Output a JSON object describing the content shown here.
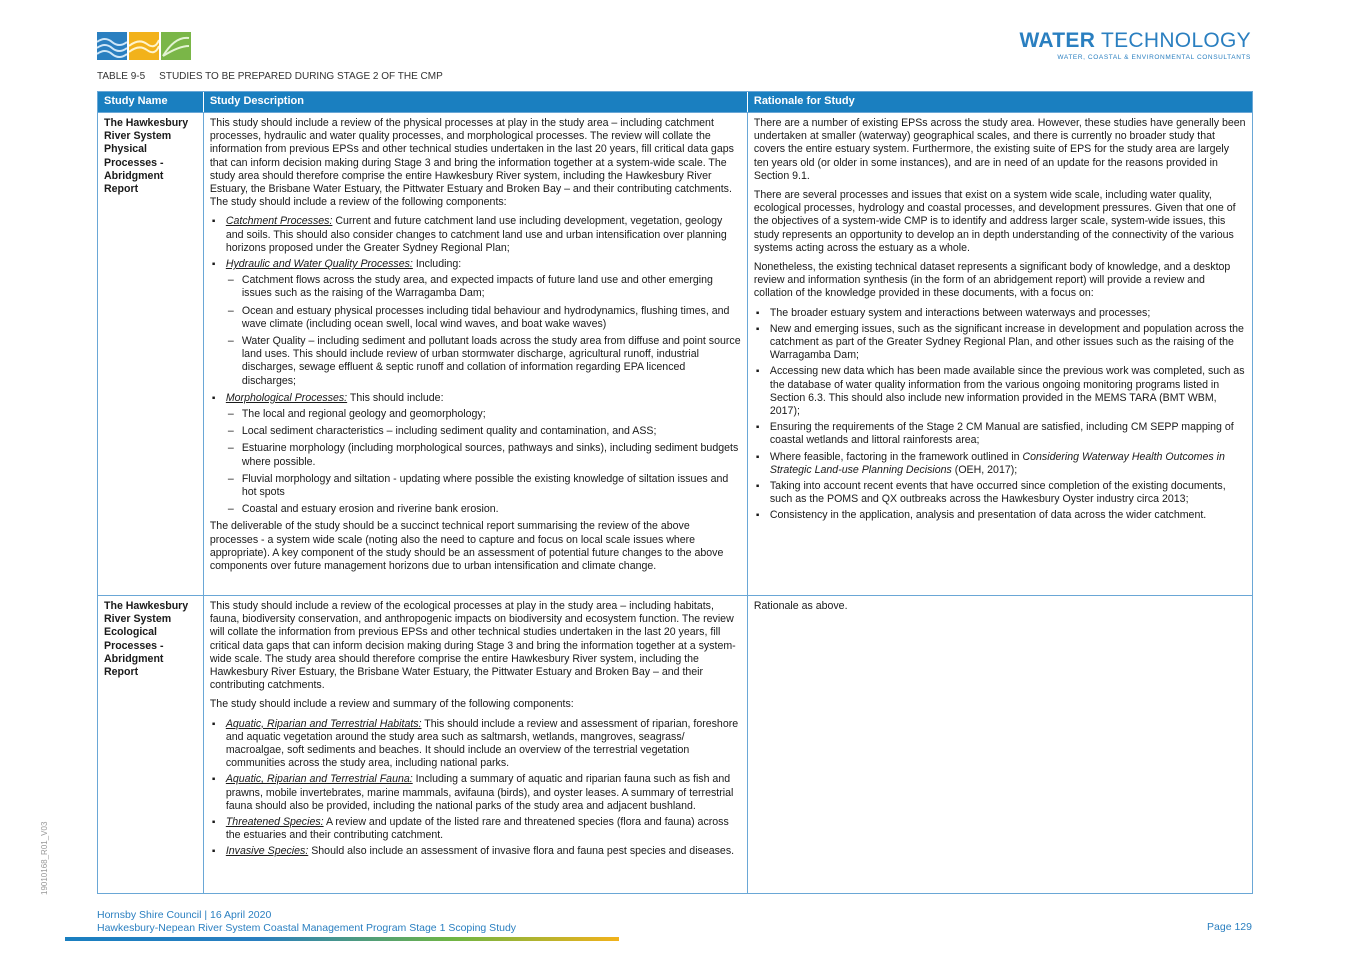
{
  "brand": {
    "name_bold": "WATER",
    "name_light": " TECHNOLOGY",
    "tagline": "WATER, COASTAL & ENVIRONMENTAL CONSULTANTS",
    "color": "#2a7fc0"
  },
  "table_title": {
    "number": "TABLE 9-5",
    "text": "STUDIES TO BE PREPARED DURING STAGE 2 OF THE CMP"
  },
  "headers": [
    "Study Name",
    "Study Description",
    "Rationale for Study"
  ],
  "row1": {
    "name": "The Hawkesbury River System Physical Processes - Abridgment Report",
    "desc_intro": "This study should include a review of the physical processes at play in the study area – including catchment processes, hydraulic and water quality processes, and morphological processes. The review will collate the information from previous EPSs and other technical studies undertaken in the last 20 years, fill critical data gaps that can inform decision making during Stage 3 and bring the information together at a system-wide scale. The study area should therefore comprise the entire Hawkesbury River system, including the Hawkesbury River Estuary, the Brisbane Water Estuary, the Pittwater Estuary and Broken Bay – and their contributing catchments. The study should include a review of the following components:",
    "catchment_title": "Catchment Processes:",
    "catchment_text": " Current and future catchment land use including development, vegetation, geology and soils. This should also consider changes to catchment land use and urban intensification over planning horizons proposed under the Greater Sydney Regional Plan;",
    "hydraulic_title": "Hydraulic and Water Quality Processes:",
    "hydraulic_text": " Including:",
    "hydraulic_items": [
      "Catchment flows across the study area, and expected impacts of future land use and other emerging issues such as the raising of the Warragamba Dam;",
      "Ocean and estuary physical processes including tidal behaviour and hydrodynamics, flushing times, and wave climate (including ocean swell, local wind waves, and boat wake waves)",
      "Water Quality – including sediment and pollutant loads across the study area from diffuse and point source land uses. This should include review of urban stormwater discharge, agricultural runoff, industrial discharges, sewage effluent & septic runoff and collation of information regarding EPA licenced discharges;"
    ],
    "morph_title": "Morphological Processes:",
    "morph_text": " This should include:",
    "morph_items": [
      "The local and regional geology and geomorphology;",
      "Local sediment characteristics – including sediment quality and contamination, and ASS;",
      "Estuarine morphology (including morphological sources, pathways and sinks), including sediment budgets where possible.",
      "Fluvial morphology and siltation - updating where possible the existing knowledge of siltation issues and hot spots",
      "Coastal and estuary erosion and riverine bank erosion."
    ],
    "desc_outro": "The deliverable of the study should be a succinct technical report summarising the review of the above processes - a system wide scale (noting also the need to capture and focus on local scale issues where appropriate). A key component of the study should be an assessment of potential future changes to the above components over future management horizons due to urban intensification and climate change.",
    "rat_p1": "There are a number of existing EPSs across the study area. However, these studies have generally been undertaken at smaller (waterway) geographical scales, and there is currently no broader study that covers the entire estuary system. Furthermore, the existing suite of EPS for the study area are largely ten years old (or older in some instances), and are in need of an update for the reasons provided in Section 9.1.",
    "rat_p2": "There are several processes and issues that exist on a system wide scale, including water quality, ecological processes, hydrology and coastal processes, and development pressures. Given that one of the objectives of a system-wide CMP is to identify and address larger scale, system-wide issues, this study represents an opportunity to develop an in depth understanding of the connectivity of the various systems acting across the estuary as a whole.",
    "rat_p3": "Nonetheless, the existing technical dataset represents a significant body of knowledge, and a desktop review and information synthesis (in the form of an abridgement report) will provide a review and collation of the knowledge provided in these documents, with a focus on:",
    "rat_items": [
      "The broader estuary system and interactions between waterways and processes;",
      "New and emerging issues, such as the significant increase in development and population across the catchment as part of the Greater Sydney Regional Plan, and other issues such as the raising of the Warragamba Dam;",
      "Accessing new data which has been made available since the previous work was completed, such as the database of water quality information from the various ongoing monitoring programs listed in Section 6.3. This should also include new information provided in the MEMS TARA (BMT WBM, 2017);",
      "Ensuring the requirements of the Stage 2 CM Manual are satisfied, including CM SEPP mapping of coastal wetlands and littoral rainforests area;"
    ],
    "rat_item5_pre": "Where feasible, factoring in the framework outlined in ",
    "rat_item5_it": "Considering Waterway Health Outcomes in Strategic Land-use Planning Decisions",
    "rat_item5_post": " (OEH, 2017);",
    "rat_items2": [
      "Taking into account recent events that have occurred since completion of the existing documents, such as the POMS and QX outbreaks across the Hawkesbury Oyster industry circa 2013;",
      "Consistency in the application, analysis and presentation of data across the wider catchment."
    ]
  },
  "row2": {
    "name": "The Hawkesbury River System Ecological Processes - Abridgment Report",
    "desc_intro": "This study should include a review of the ecological processes at play in the study area – including habitats, fauna, biodiversity conservation, and anthropogenic impacts on biodiversity and ecosystem function. The review will collate the information from previous EPSs and other technical studies undertaken in the last 20 years, fill critical data gaps that can inform decision making during Stage 3 and bring the information together at a system-wide scale. The study area should therefore comprise the entire Hawkesbury River system, including the Hawkesbury River Estuary, the Brisbane Water Estuary, the Pittwater Estuary and Broken Bay – and their contributing catchments.",
    "desc_p2": "The study should include a review and summary of the following components:",
    "items": [
      {
        "title": "Aquatic, Riparian and Terrestrial Habitats:",
        "text": " This should include a review and assessment of riparian, foreshore and aquatic vegetation around the study area such as saltmarsh, wetlands, mangroves, seagrass/ macroalgae, soft sediments and beaches. It should include an overview of the terrestrial vegetation communities across the study area, including national parks."
      },
      {
        "title": "Aquatic, Riparian and Terrestrial Fauna:",
        "text": " Including a summary of aquatic and riparian fauna such as fish and prawns, mobile invertebrates, marine mammals, avifauna (birds), and oyster leases. A summary of terrestrial fauna should also be provided, including the national parks of the study area and adjacent bushland."
      },
      {
        "title": "Threatened Species:",
        "text": " A review and update of the listed rare and threatened species (flora and fauna) across the estuaries and their contributing catchment."
      },
      {
        "title": "Invasive Species:",
        "text": " Should also include an assessment of invasive flora and fauna pest species and diseases."
      }
    ],
    "rationale": "Rationale as above."
  },
  "doc_id": "19010168_R01_V03",
  "footer": {
    "line1": "Hornsby Shire Council | 16 April 2020",
    "line2": "Hawkesbury-Nepean River System Coastal Management Program Stage 1 Scoping Study",
    "page": "Page 129"
  }
}
